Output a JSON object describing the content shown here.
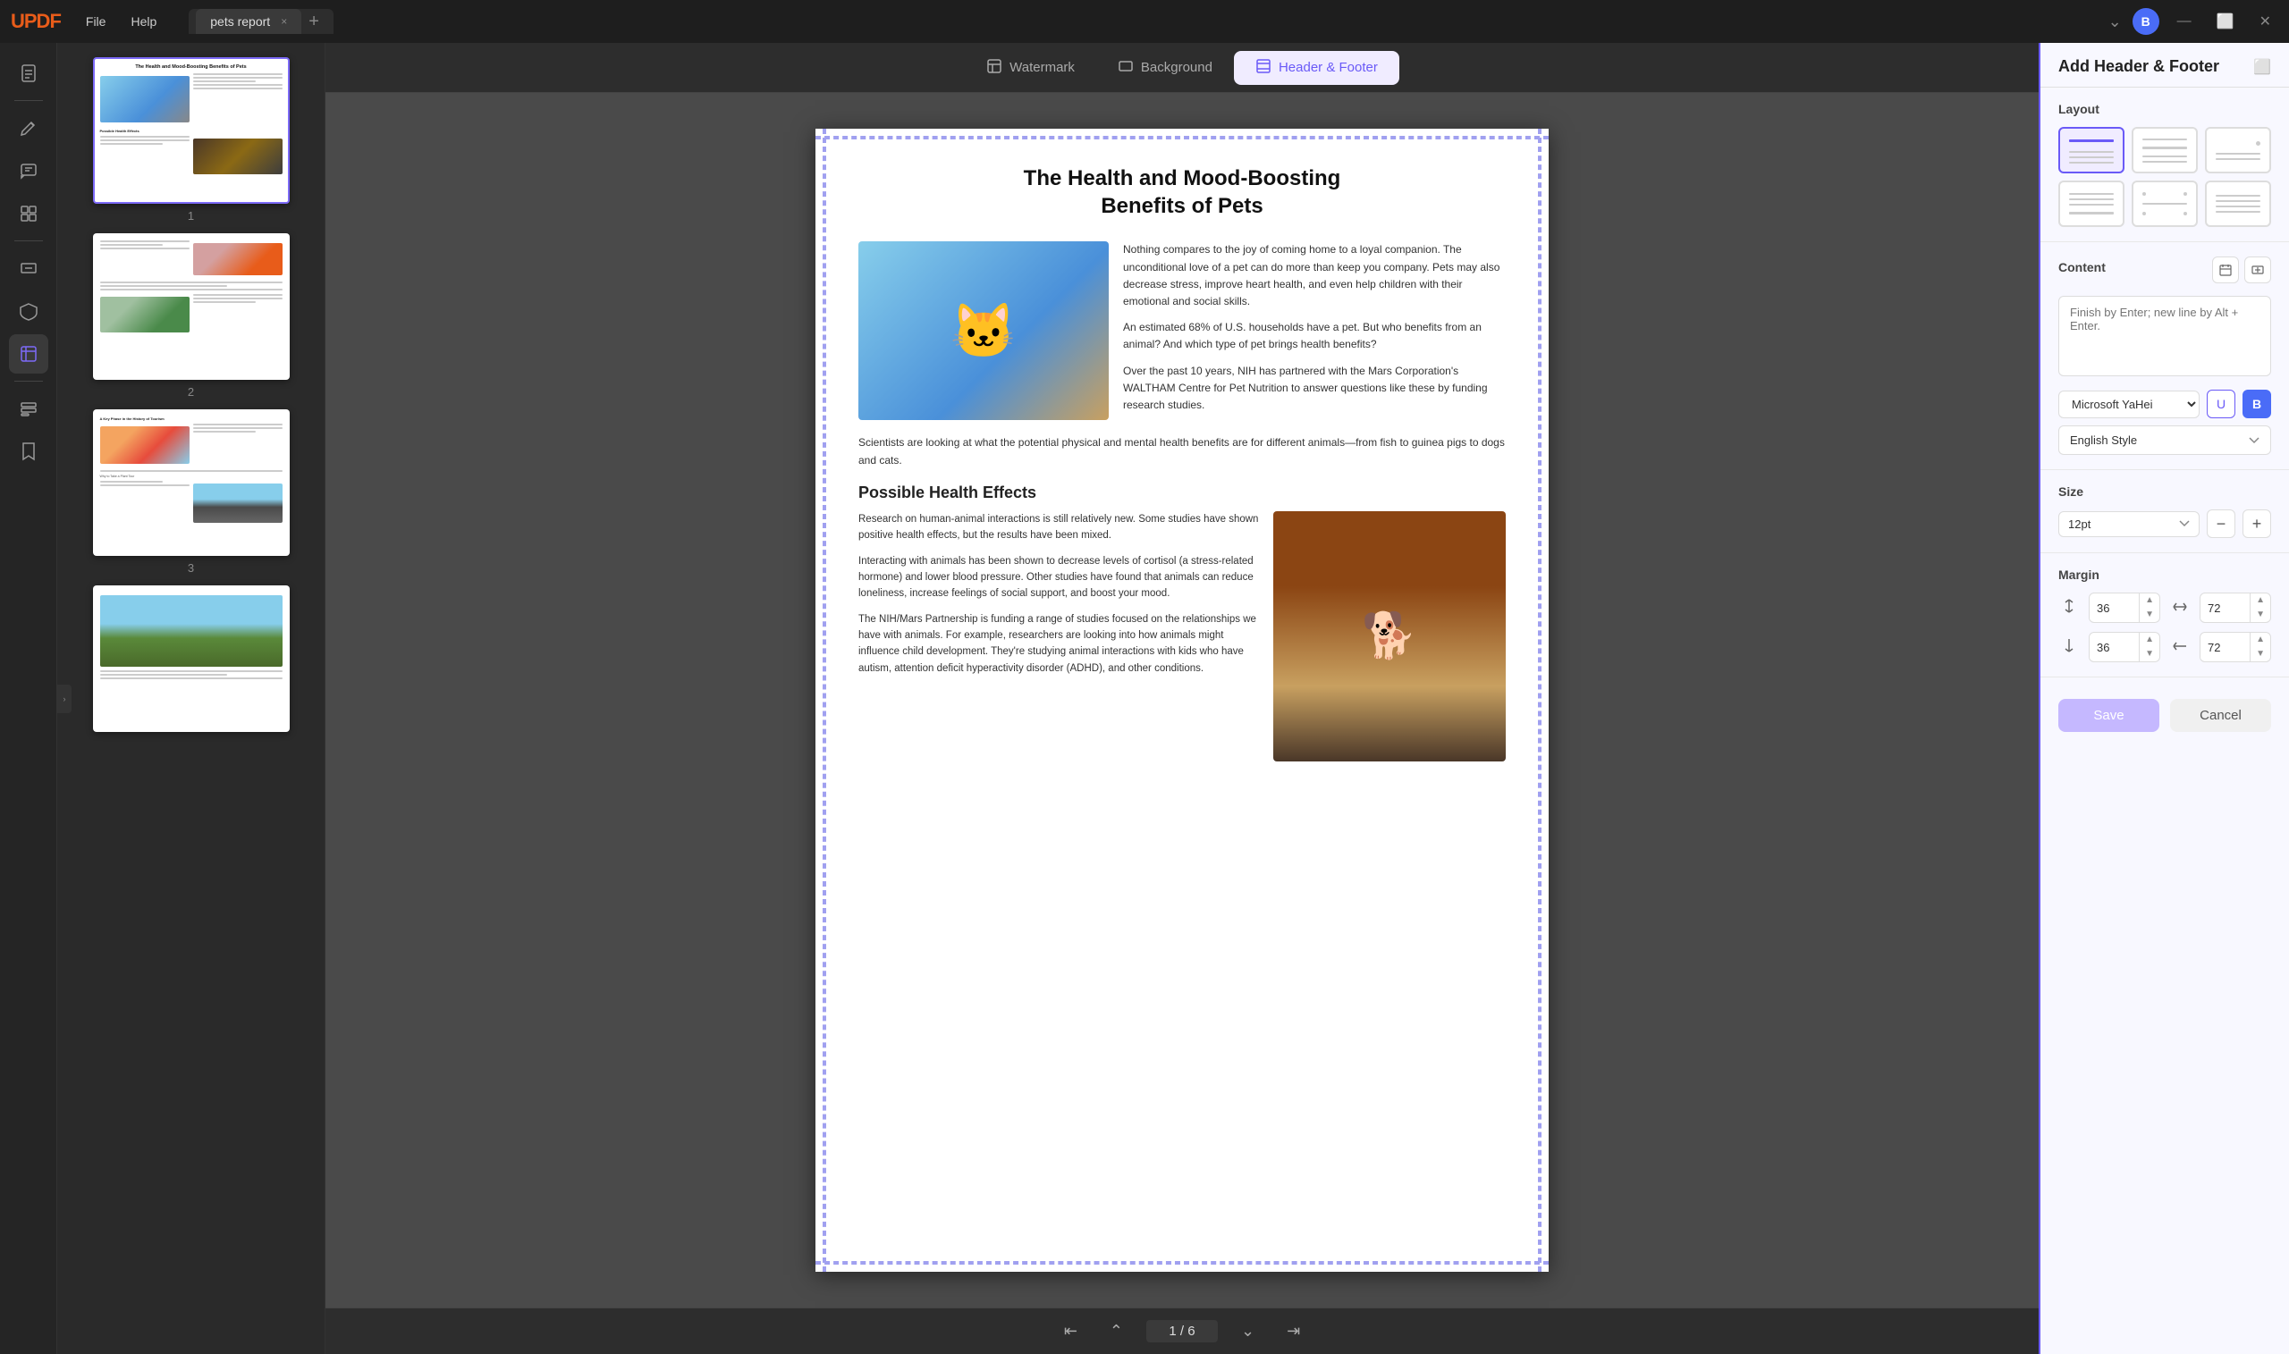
{
  "app": {
    "name": "UPDF",
    "logo": "UPDF"
  },
  "titlebar": {
    "menu_file": "File",
    "menu_help": "Help",
    "tab_name": "pets report",
    "tab_close": "×",
    "tab_add": "+",
    "user_initial": "B",
    "nav_chevron": "⌄"
  },
  "toolbar": {
    "watermark_label": "Watermark",
    "background_label": "Background",
    "header_footer_label": "Header & Footer"
  },
  "thumbnails": [
    {
      "num": "1",
      "title": "The Health and Mood-Boosting Benefits of Pets",
      "selected": true
    },
    {
      "num": "2",
      "title": "",
      "selected": false
    },
    {
      "num": "3",
      "title": "A Key Phase in the History of Tourism",
      "selected": false
    }
  ],
  "document": {
    "title_line1": "The Health and Mood-Boosting",
    "title_line2": "Benefits of Pets",
    "para1": "Nothing compares to the joy of coming home to a loyal companion. The unconditional love of a pet can do more than keep you company. Pets may also decrease stress, improve heart health, and even help children with their emotional and social skills.",
    "para2": "An estimated 68% of U.S. households have a pet. But who benefits from an animal? And which type of pet brings health benefits?",
    "para3": "Over the past 10 years, NIH has partnered with the Mars Corporation's WALTHAM Centre for Pet Nutrition to answer questions like these by funding research studies.",
    "para4": "Scientists are looking at what the potential physical and mental health benefits are for different animals—from fish to guinea pigs to dogs and cats.",
    "section_title": "Possible Health Effects",
    "section_para1": "Research on human-animal interactions is still relatively new. Some studies have shown positive health effects, but the results have been mixed.",
    "section_para2": "Interacting with animals has been shown to decrease levels of cortisol (a stress-related hormone) and lower blood pressure. Other studies have found that animals can reduce loneliness, increase feelings of social support, and boost your mood.",
    "section_para3": "The NIH/Mars Partnership is funding a range of studies focused on the relationships we have with animals. For example, researchers are looking into how animals might influence child development. They're studying animal interactions with kids who have autism, attention deficit hyperactivity disorder (ADHD), and other conditions."
  },
  "page_nav": {
    "current": "1",
    "total": "6",
    "separator": "/"
  },
  "right_panel": {
    "title": "Add Header & Footer",
    "layout_section": "Layout",
    "content_section": "Content",
    "content_placeholder": "Finish by Enter; new line by Alt + Enter.",
    "font_family": "Microsoft YaHei",
    "style_label": "English Style",
    "size_section": "Size",
    "size_value": "12pt",
    "margin_section": "Margin",
    "margin_top": "36",
    "margin_right": "72",
    "margin_bottom": "36",
    "margin_right2": "72",
    "save_label": "Save",
    "cancel_label": "Cancel",
    "layout_options": [
      {
        "id": 1,
        "type": "top-line",
        "selected": true
      },
      {
        "id": 2,
        "type": "center-line",
        "selected": false
      },
      {
        "id": 3,
        "type": "dots",
        "selected": false
      },
      {
        "id": 4,
        "type": "bottom-line",
        "selected": false
      },
      {
        "id": 5,
        "type": "corner-dots",
        "selected": false
      },
      {
        "id": 6,
        "type": "lines",
        "selected": false
      }
    ]
  },
  "icons": {
    "watermark": "≡",
    "background": "▭",
    "header_footer": "⊞",
    "save_calendar": "📅",
    "save_file": "💾",
    "margin_top_icon": "⇕",
    "margin_side_icon": "⇔",
    "underline": "U",
    "bold": "B"
  }
}
